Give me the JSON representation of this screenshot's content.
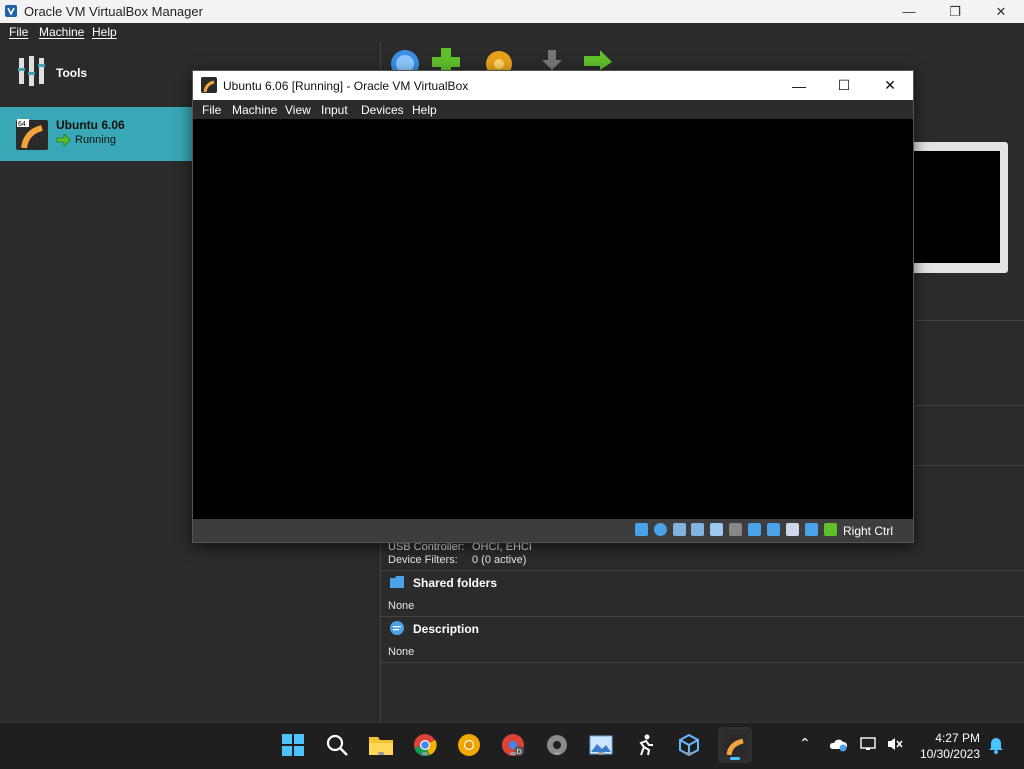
{
  "manager": {
    "title": "Oracle VM VirtualBox Manager",
    "menu": [
      "File",
      "Machine",
      "Help"
    ],
    "tools_label": "Tools",
    "vm_list": [
      {
        "name": "Ubuntu 6.06",
        "state": "Running",
        "badge": "64"
      }
    ],
    "details": {
      "usb_controller_label": "USB Controller:",
      "usb_controller_value": "OHCI, EHCI",
      "device_filters_label": "Device Filters:",
      "device_filters_value": "0 (0 active)",
      "shared_folders_title": "Shared folders",
      "shared_folders_value": "None",
      "description_title": "Description",
      "description_value": "None"
    }
  },
  "vm_window": {
    "title": "Ubuntu 6.06 [Running] - Oracle VM VirtualBox",
    "menu": [
      "File",
      "Machine",
      "View",
      "Input",
      "Devices",
      "Help"
    ],
    "host_key": "Right Ctrl"
  },
  "taskbar": {
    "time": "4:27 PM",
    "date": "10/30/2023"
  },
  "colors": {
    "selection": "#3aa7b6",
    "background": "#2b2b2b"
  }
}
